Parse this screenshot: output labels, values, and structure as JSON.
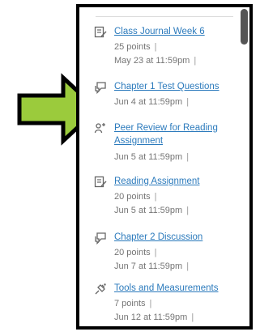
{
  "items": [
    {
      "icon": "assignment-icon",
      "title": "Class Journal Week 6",
      "points": "25 points",
      "date": "May 23 at 11:59pm"
    },
    {
      "icon": "discussion-icon",
      "title": "Chapter 1 Test Questions",
      "points": "",
      "date": "Jun 4 at 11:59pm"
    },
    {
      "icon": "peer-review-icon",
      "title": "Peer Review for Reading Assignment",
      "points": "",
      "date": "Jun 5 at 11:59pm"
    },
    {
      "icon": "assignment-icon",
      "title": "Reading Assignment",
      "points": "20 points",
      "date": "Jun 5 at 11:59pm"
    },
    {
      "icon": "discussion-icon",
      "title": "Chapter 2 Discussion",
      "points": "20 points",
      "date": "Jun 7 at 11:59pm"
    },
    {
      "icon": "quiz-icon",
      "title": "Tools and Measurements",
      "points": "7 points",
      "date": "Jun 12 at 11:59pm"
    }
  ],
  "separator": "|",
  "colors": {
    "link": "#2b7abc",
    "meta": "#757575",
    "arrow_fill": "#9bcb3c",
    "border": "#000000"
  }
}
